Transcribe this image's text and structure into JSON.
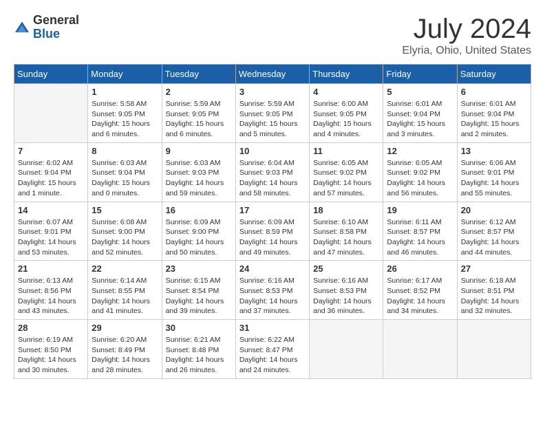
{
  "header": {
    "logo_general": "General",
    "logo_blue": "Blue",
    "month_title": "July 2024",
    "location": "Elyria, Ohio, United States"
  },
  "weekdays": [
    "Sunday",
    "Monday",
    "Tuesday",
    "Wednesday",
    "Thursday",
    "Friday",
    "Saturday"
  ],
  "weeks": [
    [
      {
        "day": "",
        "empty": true
      },
      {
        "day": "1",
        "sunrise": "5:58 AM",
        "sunset": "9:05 PM",
        "daylight": "15 hours and 6 minutes."
      },
      {
        "day": "2",
        "sunrise": "5:59 AM",
        "sunset": "9:05 PM",
        "daylight": "15 hours and 6 minutes."
      },
      {
        "day": "3",
        "sunrise": "5:59 AM",
        "sunset": "9:05 PM",
        "daylight": "15 hours and 5 minutes."
      },
      {
        "day": "4",
        "sunrise": "6:00 AM",
        "sunset": "9:05 PM",
        "daylight": "15 hours and 4 minutes."
      },
      {
        "day": "5",
        "sunrise": "6:01 AM",
        "sunset": "9:04 PM",
        "daylight": "15 hours and 3 minutes."
      },
      {
        "day": "6",
        "sunrise": "6:01 AM",
        "sunset": "9:04 PM",
        "daylight": "15 hours and 2 minutes."
      }
    ],
    [
      {
        "day": "7",
        "sunrise": "6:02 AM",
        "sunset": "9:04 PM",
        "daylight": "15 hours and 1 minute."
      },
      {
        "day": "8",
        "sunrise": "6:03 AM",
        "sunset": "9:04 PM",
        "daylight": "15 hours and 0 minutes."
      },
      {
        "day": "9",
        "sunrise": "6:03 AM",
        "sunset": "9:03 PM",
        "daylight": "14 hours and 59 minutes."
      },
      {
        "day": "10",
        "sunrise": "6:04 AM",
        "sunset": "9:03 PM",
        "daylight": "14 hours and 58 minutes."
      },
      {
        "day": "11",
        "sunrise": "6:05 AM",
        "sunset": "9:02 PM",
        "daylight": "14 hours and 57 minutes."
      },
      {
        "day": "12",
        "sunrise": "6:05 AM",
        "sunset": "9:02 PM",
        "daylight": "14 hours and 56 minutes."
      },
      {
        "day": "13",
        "sunrise": "6:06 AM",
        "sunset": "9:01 PM",
        "daylight": "14 hours and 55 minutes."
      }
    ],
    [
      {
        "day": "14",
        "sunrise": "6:07 AM",
        "sunset": "9:01 PM",
        "daylight": "14 hours and 53 minutes."
      },
      {
        "day": "15",
        "sunrise": "6:08 AM",
        "sunset": "9:00 PM",
        "daylight": "14 hours and 52 minutes."
      },
      {
        "day": "16",
        "sunrise": "6:09 AM",
        "sunset": "9:00 PM",
        "daylight": "14 hours and 50 minutes."
      },
      {
        "day": "17",
        "sunrise": "6:09 AM",
        "sunset": "8:59 PM",
        "daylight": "14 hours and 49 minutes."
      },
      {
        "day": "18",
        "sunrise": "6:10 AM",
        "sunset": "8:58 PM",
        "daylight": "14 hours and 47 minutes."
      },
      {
        "day": "19",
        "sunrise": "6:11 AM",
        "sunset": "8:57 PM",
        "daylight": "14 hours and 46 minutes."
      },
      {
        "day": "20",
        "sunrise": "6:12 AM",
        "sunset": "8:57 PM",
        "daylight": "14 hours and 44 minutes."
      }
    ],
    [
      {
        "day": "21",
        "sunrise": "6:13 AM",
        "sunset": "8:56 PM",
        "daylight": "14 hours and 43 minutes."
      },
      {
        "day": "22",
        "sunrise": "6:14 AM",
        "sunset": "8:55 PM",
        "daylight": "14 hours and 41 minutes."
      },
      {
        "day": "23",
        "sunrise": "6:15 AM",
        "sunset": "8:54 PM",
        "daylight": "14 hours and 39 minutes."
      },
      {
        "day": "24",
        "sunrise": "6:16 AM",
        "sunset": "8:53 PM",
        "daylight": "14 hours and 37 minutes."
      },
      {
        "day": "25",
        "sunrise": "6:16 AM",
        "sunset": "8:53 PM",
        "daylight": "14 hours and 36 minutes."
      },
      {
        "day": "26",
        "sunrise": "6:17 AM",
        "sunset": "8:52 PM",
        "daylight": "14 hours and 34 minutes."
      },
      {
        "day": "27",
        "sunrise": "6:18 AM",
        "sunset": "8:51 PM",
        "daylight": "14 hours and 32 minutes."
      }
    ],
    [
      {
        "day": "28",
        "sunrise": "6:19 AM",
        "sunset": "8:50 PM",
        "daylight": "14 hours and 30 minutes."
      },
      {
        "day": "29",
        "sunrise": "6:20 AM",
        "sunset": "8:49 PM",
        "daylight": "14 hours and 28 minutes."
      },
      {
        "day": "30",
        "sunrise": "6:21 AM",
        "sunset": "8:48 PM",
        "daylight": "14 hours and 26 minutes."
      },
      {
        "day": "31",
        "sunrise": "6:22 AM",
        "sunset": "8:47 PM",
        "daylight": "14 hours and 24 minutes."
      },
      {
        "day": "",
        "empty": true
      },
      {
        "day": "",
        "empty": true
      },
      {
        "day": "",
        "empty": true
      }
    ]
  ]
}
